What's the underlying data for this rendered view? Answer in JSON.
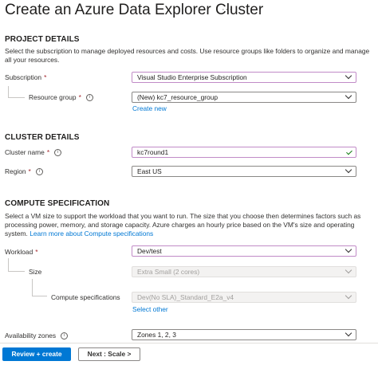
{
  "page": {
    "title": "Create an Azure Data Explorer Cluster",
    "more": "···"
  },
  "project": {
    "heading": "PROJECT DETAILS",
    "description": "Select the subscription to manage deployed resources and costs. Use resource groups like folders to organize and manage all your resources.",
    "subscription": {
      "label": "Subscription",
      "required": "*",
      "value": "Visual Studio Enterprise Subscription"
    },
    "resource_group": {
      "label": "Resource group",
      "required": "*",
      "value": "(New) kc7_resource_group",
      "create_new": "Create new"
    }
  },
  "cluster": {
    "heading": "CLUSTER DETAILS",
    "name": {
      "label": "Cluster name",
      "required": "*",
      "value": "kc7round1"
    },
    "region": {
      "label": "Region",
      "required": "*",
      "value": "East US"
    }
  },
  "compute": {
    "heading": "COMPUTE SPECIFICATION",
    "description": "Select a VM size to support the workload that you want to run. The size that you choose then determines factors such as processing power, memory, and storage capacity. Azure charges an hourly price based on the VM's size and operating system.",
    "learn_more": "Learn more about Compute specifications",
    "workload": {
      "label": "Workload",
      "required": "*",
      "value": "Dev/test"
    },
    "size": {
      "label": "Size",
      "value": "Extra Small (2 cores)"
    },
    "compute_specs": {
      "label": "Compute specifications",
      "value": "Dev(No SLA)_Standard_E2a_v4",
      "select_other": "Select other"
    },
    "availability_zones": {
      "label": "Availability zones",
      "value": "Zones 1, 2, 3"
    }
  },
  "footer": {
    "review_create": "Review + create",
    "next": "Next : Scale >"
  },
  "colors": {
    "accent": "#0078d4",
    "required": "#a4262c",
    "focus_border": "#c18bc7",
    "valid_check": "#107c10"
  },
  "icons": [
    "info-icon",
    "chevron-down-icon",
    "checkmark-icon",
    "more-icon"
  ]
}
